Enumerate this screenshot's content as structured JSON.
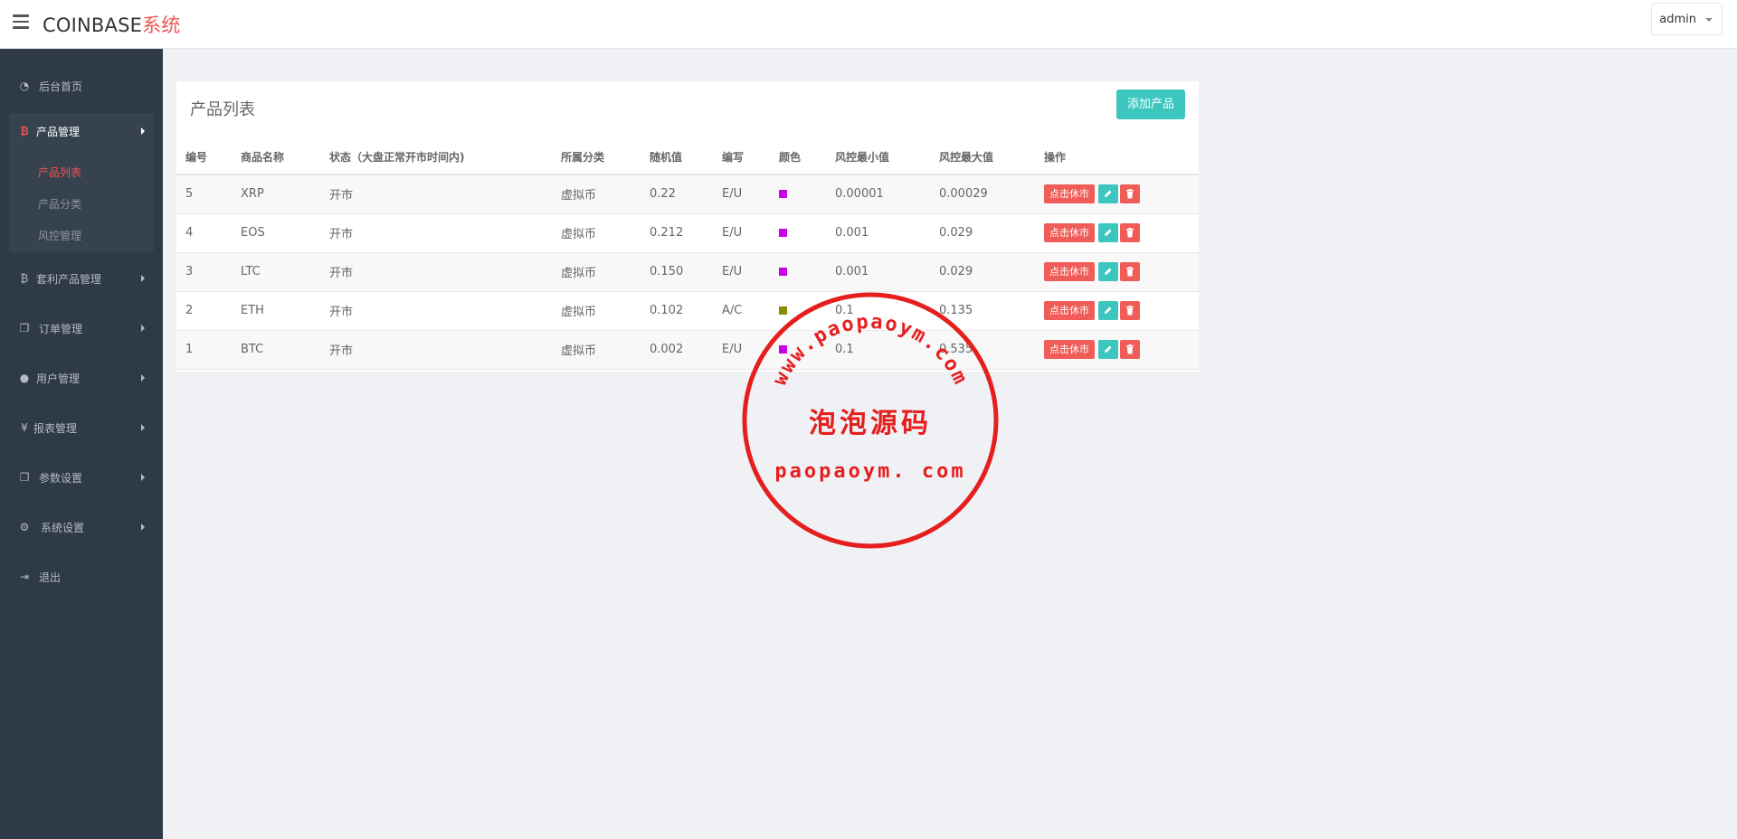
{
  "header": {
    "brand_main": "COINBASE",
    "brand_accent": "系统",
    "user": "admin"
  },
  "sidebar": {
    "home": "后台首页",
    "product_mgmt": "产品管理",
    "product_list": "产品列表",
    "product_category": "产品分类",
    "risk_mgmt": "风控管理",
    "arbitrage": "套利产品管理",
    "orders": "订单管理",
    "users": "用户管理",
    "reports": "报表管理",
    "params": "参数设置",
    "system": "系统设置",
    "logout": "退出"
  },
  "panel": {
    "title": "产品列表",
    "add_button": "添加产品"
  },
  "table": {
    "headers": [
      "编号",
      "商品名称",
      "状态（大盘正常开市时间内)",
      "所属分类",
      "随机值",
      "编写",
      "颜色",
      "风控最小值",
      "风控最大值",
      "操作"
    ],
    "rows": [
      {
        "id": "5",
        "name": "XRP",
        "status": "开市",
        "category": "虚拟币",
        "random": "0.22",
        "code": "E/U",
        "color": "#c800e6",
        "min": "0.00001",
        "max": "0.00029",
        "action": "点击休市"
      },
      {
        "id": "4",
        "name": "EOS",
        "status": "开市",
        "category": "虚拟币",
        "random": "0.212",
        "code": "E/U",
        "color": "#c800e6",
        "min": "0.001",
        "max": "0.029",
        "action": "点击休市"
      },
      {
        "id": "3",
        "name": "LTC",
        "status": "开市",
        "category": "虚拟币",
        "random": "0.150",
        "code": "E/U",
        "color": "#c800e6",
        "min": "0.001",
        "max": "0.029",
        "action": "点击休市"
      },
      {
        "id": "2",
        "name": "ETH",
        "status": "开市",
        "category": "虚拟币",
        "random": "0.102",
        "code": "A/C",
        "color": "#8a8a00",
        "min": "0.1",
        "max": "0.135",
        "action": "点击休市"
      },
      {
        "id": "1",
        "name": "BTC",
        "status": "开市",
        "category": "虚拟币",
        "random": "0.002",
        "code": "E/U",
        "color": "#c800e6",
        "min": "0.1",
        "max": "0.535",
        "action": "点击休市"
      }
    ]
  },
  "watermark": {
    "arc": "www.paopaoym.com",
    "cn": "泡泡源码",
    "url": "paopaoym. com"
  }
}
